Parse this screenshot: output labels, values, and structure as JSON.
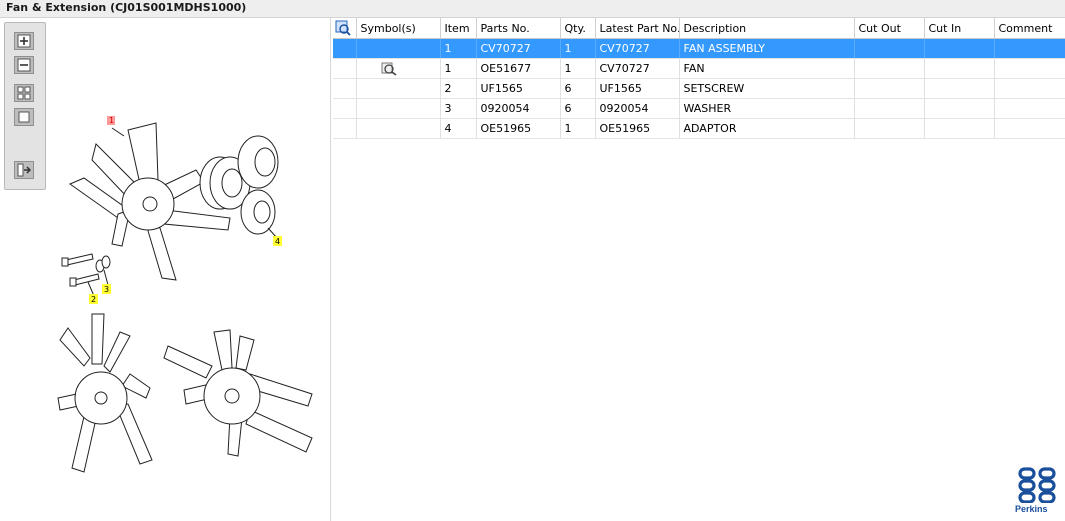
{
  "window": {
    "title": "Fan & Extension (CJ01S001MDHS1000)"
  },
  "toolbar": {
    "buttons": [
      {
        "name": "zoom-in-icon"
      },
      {
        "name": "zoom-out-icon"
      },
      {
        "name": "fit-grid-icon"
      },
      {
        "name": "actual-size-icon"
      },
      {
        "name": "export-icon"
      }
    ]
  },
  "diagram": {
    "callouts": [
      "1",
      "2",
      "3",
      "4"
    ]
  },
  "table": {
    "columns": [
      "",
      "Symbol(s)",
      "Item",
      "Parts No.",
      "Qty.",
      "Latest Part No.",
      "Description",
      "Cut Out",
      "Cut In",
      "Comment"
    ],
    "rows": [
      {
        "symbol": "",
        "item": "1",
        "parts_no": "CV70727",
        "qty": "1",
        "latest": "CV70727",
        "description": "FAN ASSEMBLY",
        "cut_out": "",
        "cut_in": "",
        "comment": ""
      },
      {
        "symbol": "magnifier-icon",
        "item": "1",
        "parts_no": "OE51677",
        "qty": "1",
        "latest": "CV70727",
        "description": "FAN",
        "cut_out": "",
        "cut_in": "",
        "comment": ""
      },
      {
        "symbol": "",
        "item": "2",
        "parts_no": "UF1565",
        "qty": "6",
        "latest": "UF1565",
        "description": "SETSCREW",
        "cut_out": "",
        "cut_in": "",
        "comment": ""
      },
      {
        "symbol": "",
        "item": "3",
        "parts_no": "0920054",
        "qty": "6",
        "latest": "0920054",
        "description": "WASHER",
        "cut_out": "",
        "cut_in": "",
        "comment": ""
      },
      {
        "symbol": "",
        "item": "4",
        "parts_no": "OE51965",
        "qty": "1",
        "latest": "OE51965",
        "description": "ADAPTOR",
        "cut_out": "",
        "cut_in": "",
        "comment": ""
      }
    ]
  },
  "brand": {
    "name": "Perkins",
    "color": "#1a4f9c"
  },
  "colors": {
    "selection": "#3399ff",
    "callout": "#ffff33",
    "callout_1": "#ff9a9a"
  }
}
